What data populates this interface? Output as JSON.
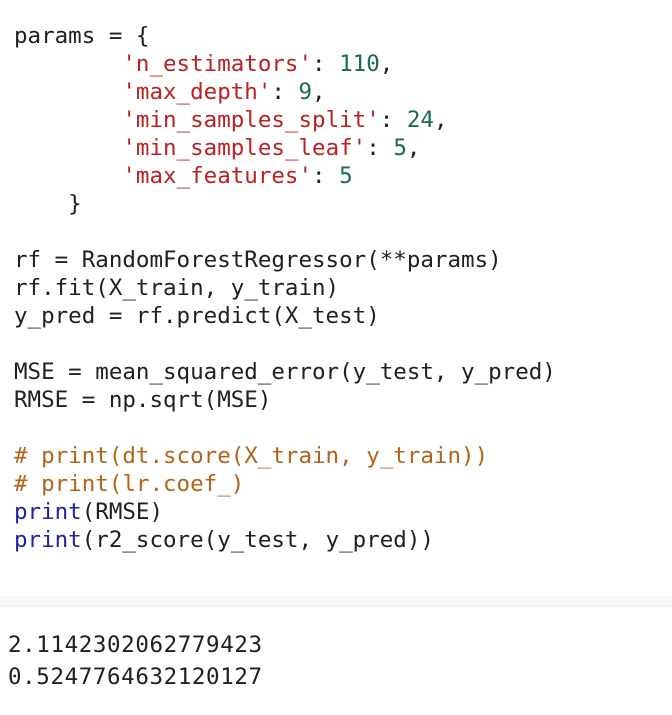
{
  "code": {
    "l1_a": "params = {",
    "l2_indent": "        ",
    "l2_key": "'n_estimators'",
    "l2_sep": ": ",
    "l2_val": "110",
    "l2_end": ",",
    "l3_indent": "        ",
    "l3_key": "'max_depth'",
    "l3_sep": ": ",
    "l3_val": "9",
    "l3_end": ",",
    "l4_indent": "        ",
    "l4_key": "'min_samples_split'",
    "l4_sep": ": ",
    "l4_val": "24",
    "l4_end": ",",
    "l5_indent": "        ",
    "l5_key": "'min_samples_leaf'",
    "l5_sep": ": ",
    "l5_val": "5",
    "l5_end": ",",
    "l6_indent": "        ",
    "l6_key": "'max_features'",
    "l6_sep": ": ",
    "l6_val": "5",
    "l7": "    }",
    "l9": "rf = RandomForestRegressor(**params)",
    "l10": "rf.fit(X_train, y_train)",
    "l11": "y_pred = rf.predict(X_test)",
    "l13": "MSE = mean_squared_error(y_test, y_pred)",
    "l14": "RMSE = np.sqrt(MSE)",
    "l16": "# print(dt.score(X_train, y_train))",
    "l17": "# print(lr.coef_)",
    "l18_fn": "print",
    "l18_rest": "(RMSE)",
    "l19_fn": "print",
    "l19_rest": "(r2_score(y_test, y_pred))"
  },
  "output": {
    "rmse": "2.1142302062779423",
    "r2": "0.5247764632120127"
  },
  "colors": {
    "string": "#ba2121",
    "number": "#1a6b4a",
    "comment": "#b4641a",
    "builtin": "#2222a0",
    "text": "#202020"
  }
}
